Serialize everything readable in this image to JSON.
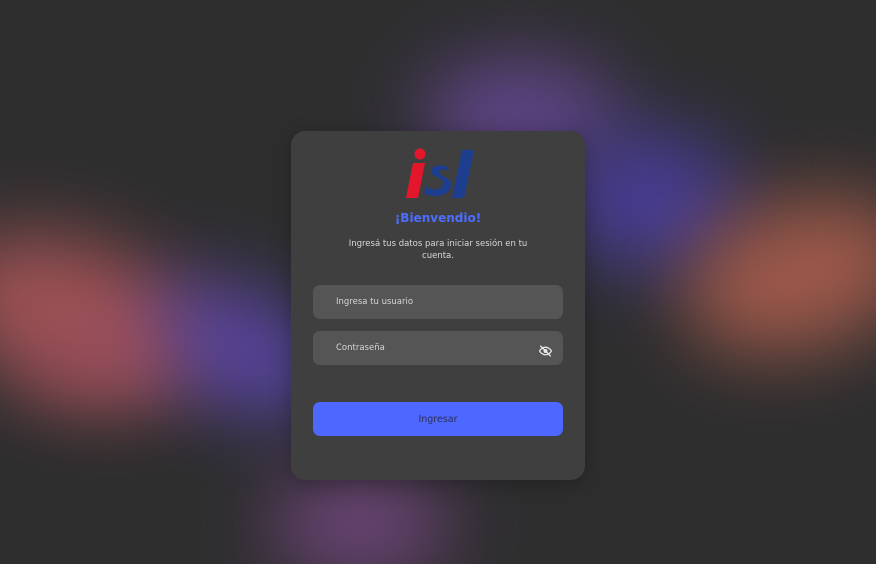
{
  "logo": {
    "text": "isl",
    "colors": {
      "i": "#e3162b",
      "sl": "#1d3e8f"
    }
  },
  "welcome_title": "¡Bienvendio!",
  "subtitle": "Ingresá tus datos para iniciar sesión en tu cuenta.",
  "username": {
    "placeholder": "Ingresa tu usuario",
    "value": ""
  },
  "password": {
    "placeholder": "Contraseña",
    "value": "",
    "toggle_icon": "eye-off-icon"
  },
  "submit_label": "Ingresar",
  "colors": {
    "accent": "#4d67ff",
    "card": "#3f3f40",
    "field": "#555556",
    "background": "#2e2e2f"
  }
}
